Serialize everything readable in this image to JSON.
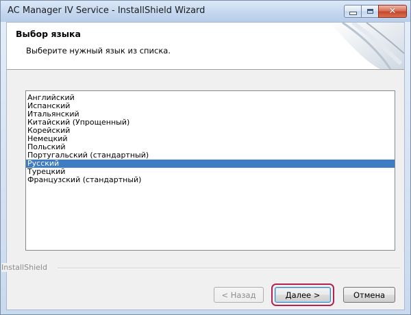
{
  "window": {
    "title": "AC Manager IV Service - InstallShield Wizard"
  },
  "title_buttons": {
    "minimize_icon": "minimize-icon",
    "maximize_icon": "maximize-icon",
    "close_icon": "close-icon",
    "close_glyph": "✕"
  },
  "header": {
    "title": "Выбор языка",
    "subtitle": "Выберите нужный язык из списка."
  },
  "languages": [
    "Английский",
    "Испанский",
    "Итальянский",
    "Китайский (Упрощенный)",
    "Корейский",
    "Немецкий",
    "Польский",
    "Португальский (стандартный)",
    "Русский",
    "Турецкий",
    "Французский (стандартный)"
  ],
  "selected_language": "Русский",
  "branding": {
    "text": "InstallShield"
  },
  "buttons": {
    "back": "< Назад",
    "next": "Далее >",
    "cancel": "Отмена"
  },
  "colors": {
    "selection": "#3e7cc4",
    "highlight_ring": "#b5214f"
  }
}
